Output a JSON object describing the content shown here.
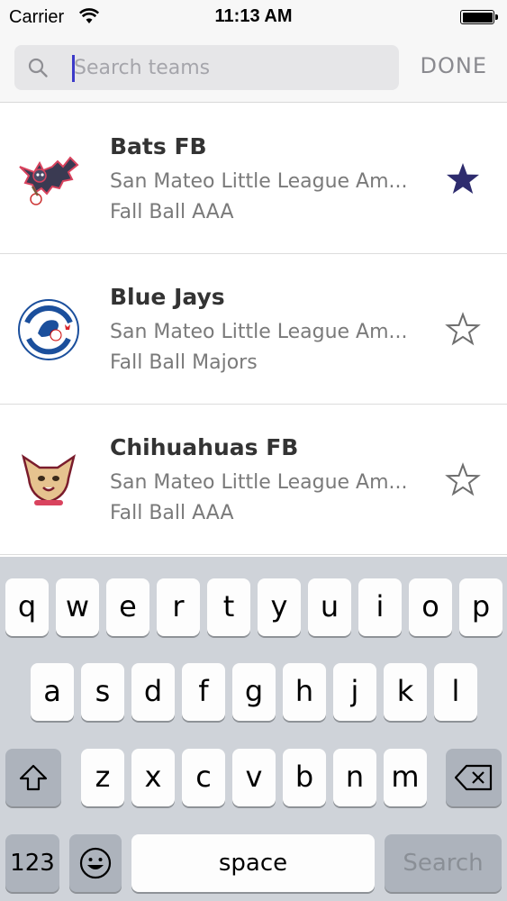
{
  "status_bar": {
    "carrier": "Carrier",
    "time": "11:13 AM"
  },
  "search": {
    "placeholder": "Search teams",
    "value": "",
    "done_label": "DONE"
  },
  "teams": [
    {
      "name": "Bats FB",
      "league": "San Mateo Little League Am...",
      "division": "Fall Ball AAA",
      "favorite": true,
      "logo": "bat-logo-icon"
    },
    {
      "name": "Blue Jays",
      "league": "San Mateo Little League Am...",
      "division": "Fall Ball Majors",
      "favorite": false,
      "logo": "toronto-blue-jays-logo-icon"
    },
    {
      "name": "Chihuahuas FB",
      "league": "San Mateo Little League Am...",
      "division": "Fall Ball AAA",
      "favorite": false,
      "logo": "chihuahua-logo-icon"
    }
  ],
  "keyboard": {
    "row1": [
      "q",
      "w",
      "e",
      "r",
      "t",
      "y",
      "u",
      "i",
      "o",
      "p"
    ],
    "row2": [
      "a",
      "s",
      "d",
      "f",
      "g",
      "h",
      "j",
      "k",
      "l"
    ],
    "row3": [
      "z",
      "x",
      "c",
      "v",
      "b",
      "n",
      "m"
    ],
    "numbers_label": "123",
    "space_label": "space",
    "search_label": "Search",
    "shift_icon": "shift-icon",
    "delete_icon": "delete-icon",
    "emoji_icon": "emoji-icon"
  },
  "colors": {
    "star": "#2e2c6e",
    "caret": "#3c3ac9"
  }
}
